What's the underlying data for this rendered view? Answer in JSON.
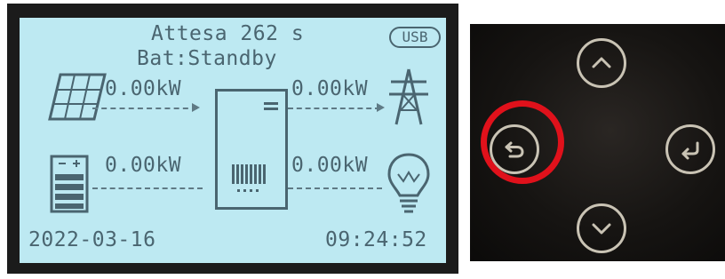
{
  "display": {
    "status_line": "Attesa 262 s",
    "battery_status": "Bat:Standby",
    "usb_badge": "USB",
    "pv_power": "0.00kW",
    "grid_power": "0.00kW",
    "battery_power": "0.00kW",
    "load_power": "0.00kW",
    "date": "2022-03-16",
    "time": "09:24:52"
  },
  "keypad": {
    "buttons": [
      {
        "name": "up-button",
        "icon": "chevron-up-icon"
      },
      {
        "name": "back-button",
        "icon": "return-arrow-icon",
        "highlighted": true
      },
      {
        "name": "enter-button",
        "icon": "enter-arrow-icon"
      },
      {
        "name": "down-button",
        "icon": "chevron-down-icon"
      }
    ],
    "highlight_color": "#e0111b",
    "ring_color": "#c9c3b4"
  },
  "colors": {
    "lcd_background": "#bde9f2",
    "lcd_text": "#4a6570"
  }
}
